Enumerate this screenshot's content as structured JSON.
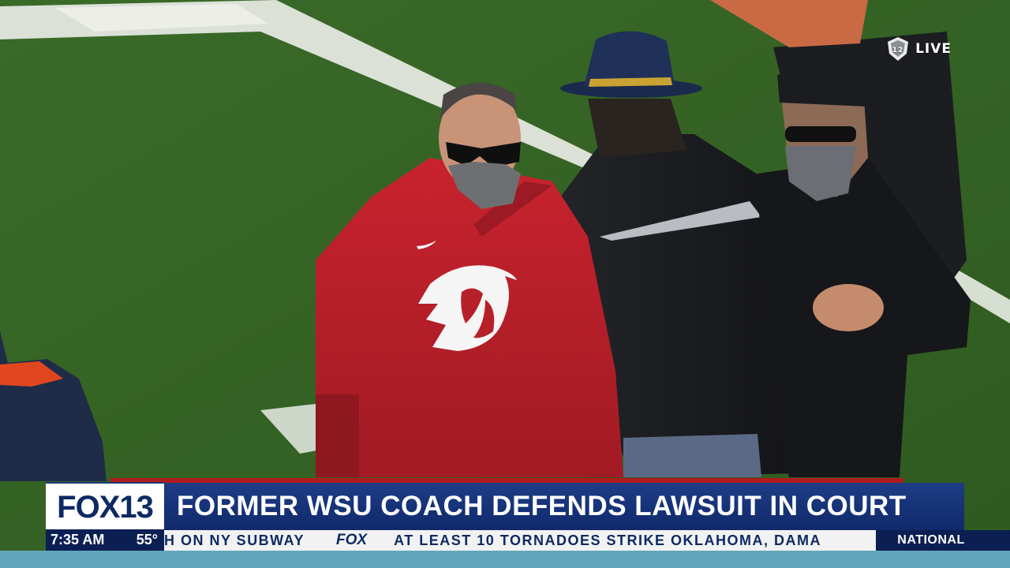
{
  "broadcast": {
    "live_label": "LIVE",
    "network_logo": "FOX13",
    "headline": "FORMER WSU COACH DEFENDS LAWSUIT IN COURT",
    "time": "7:35 AM",
    "temperature": "55°",
    "ticker_before": "H ON NY SUBWAY",
    "ticker_brand": "FOX",
    "ticker_after": "AT LEAST 10 TORNADOES STRIKE OKLAHOMA, DAMA",
    "category": "NATIONAL"
  },
  "icons": {
    "conference_logo": "pac12-logo-icon",
    "hoodie_logo": "wsu-cougar-head-icon",
    "brand_swoosh": "swoosh-icon"
  },
  "colors": {
    "turf": "#3d6a2a",
    "hoodie": "#b7202a",
    "headline_bg": "#1e3d86",
    "accent_red": "#b01c1c"
  }
}
